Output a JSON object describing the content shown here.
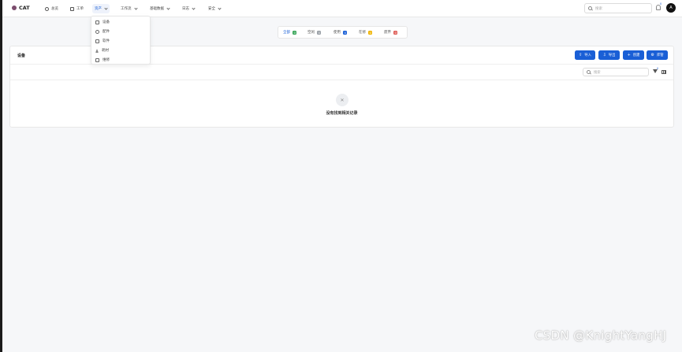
{
  "app": {
    "title": "CAT"
  },
  "nav": {
    "items": [
      {
        "label": "总览",
        "icon": "gauge-icon"
      },
      {
        "label": "工单",
        "icon": "document-icon"
      },
      {
        "label": "资产",
        "icon": "",
        "active": true
      },
      {
        "label": "工作流",
        "icon": ""
      },
      {
        "label": "基础数据",
        "icon": ""
      },
      {
        "label": "日志",
        "icon": ""
      },
      {
        "label": "安全",
        "icon": ""
      }
    ]
  },
  "top_search": {
    "placeholder": "搜索"
  },
  "notifications": {
    "count": "0"
  },
  "user": {
    "avatar_letter": "A"
  },
  "assets_menu": {
    "items": [
      {
        "label": "设备",
        "icon": "monitor-icon"
      },
      {
        "label": "配件",
        "icon": "gear-icon"
      },
      {
        "label": "软件",
        "icon": "apps-icon"
      },
      {
        "label": "耗材",
        "icon": "flask-icon"
      },
      {
        "label": "维修",
        "icon": "briefcase-icon"
      }
    ]
  },
  "status_tabs": [
    {
      "label": "全部",
      "count": "0",
      "color": "#3aa65a"
    },
    {
      "label": "空闲",
      "count": "0",
      "color": "#9aa0a6"
    },
    {
      "label": "使用",
      "count": "0",
      "color": "#1a5fd6"
    },
    {
      "label": "在修",
      "count": "0",
      "color": "#f0b400"
    },
    {
      "label": "废弃",
      "count": "0",
      "color": "#e0605a"
    }
  ],
  "card": {
    "title": "设备",
    "buttons": {
      "import": "导入",
      "export": "导出",
      "create": "创建",
      "manage": "库管"
    },
    "search_placeholder": "搜索",
    "filter_count": "0",
    "empty_text": "没有找到相关记录"
  },
  "colors": {
    "primary": "#1a5fd6"
  },
  "watermark": "CSDN @KnightYangHJ"
}
